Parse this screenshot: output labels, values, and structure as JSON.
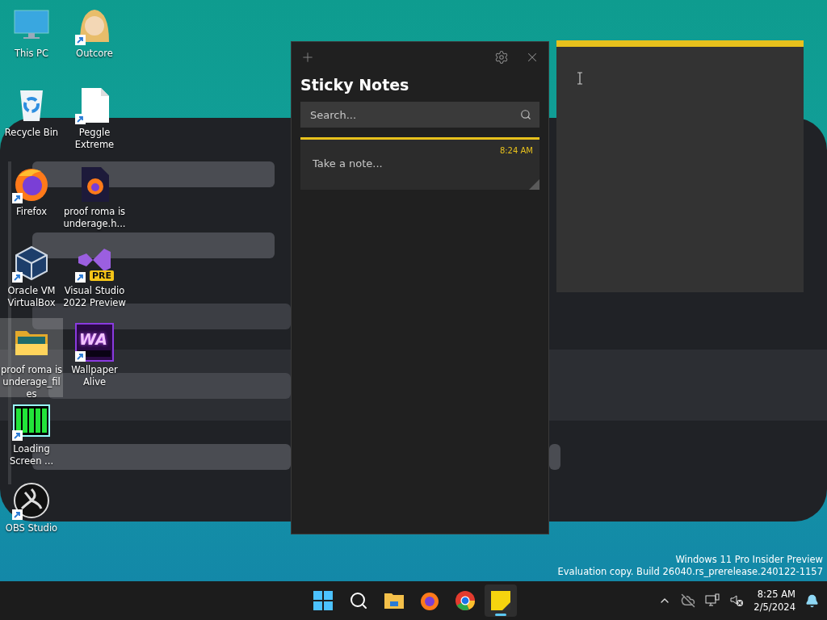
{
  "desktop_icons": [
    {
      "label": "This PC",
      "kind": "monitor",
      "shortcut": false,
      "selected": false
    },
    {
      "label": "Recycle Bin",
      "kind": "recycle",
      "shortcut": false,
      "selected": false
    },
    {
      "label": "Firefox",
      "kind": "firefox",
      "shortcut": true,
      "selected": false
    },
    {
      "label": "Oracle VM VirtualBox",
      "kind": "cube",
      "shortcut": true,
      "selected": false
    },
    {
      "label": "proof roma is underage_files",
      "kind": "folder",
      "shortcut": false,
      "selected": true
    },
    {
      "label": "Loading Screen ...",
      "kind": "bars",
      "shortcut": true,
      "selected": false
    },
    {
      "label": "OBS Studio",
      "kind": "obs",
      "shortcut": true,
      "selected": false
    },
    {
      "label": "Outcore",
      "kind": "figure",
      "shortcut": true,
      "selected": false
    },
    {
      "label": "Peggle Extreme",
      "kind": "document",
      "shortcut": true,
      "selected": false
    },
    {
      "label": "proof roma is underage.h...",
      "kind": "webfile",
      "shortcut": false,
      "selected": false
    },
    {
      "label": "Visual Studio 2022 Preview",
      "kind": "vs",
      "badge": "PRE",
      "shortcut": true,
      "selected": false
    },
    {
      "label": "Wallpaper Alive",
      "kind": "wa",
      "badge": "WA",
      "shortcut": true,
      "selected": false
    }
  ],
  "sticky_notes": {
    "title": "Sticky Notes",
    "search": {
      "placeholder": "Search..."
    },
    "notes": [
      {
        "time": "8:24 AM",
        "placeholder": "Take a note..."
      }
    ]
  },
  "evaluation_notice": [
    "Windows 11 Pro Insider Preview",
    "Evaluation copy. Build 26040.rs_prerelease.240122-1157"
  ],
  "taskbar": {
    "apps": [
      {
        "kind": "start",
        "selected": false
      },
      {
        "kind": "search",
        "selected": false
      },
      {
        "kind": "explorer",
        "selected": false
      },
      {
        "kind": "firefox",
        "selected": false
      },
      {
        "kind": "chrome",
        "selected": false
      },
      {
        "kind": "sticky",
        "selected": true
      }
    ],
    "time": "8:25 AM",
    "date": "2/5/2024"
  }
}
